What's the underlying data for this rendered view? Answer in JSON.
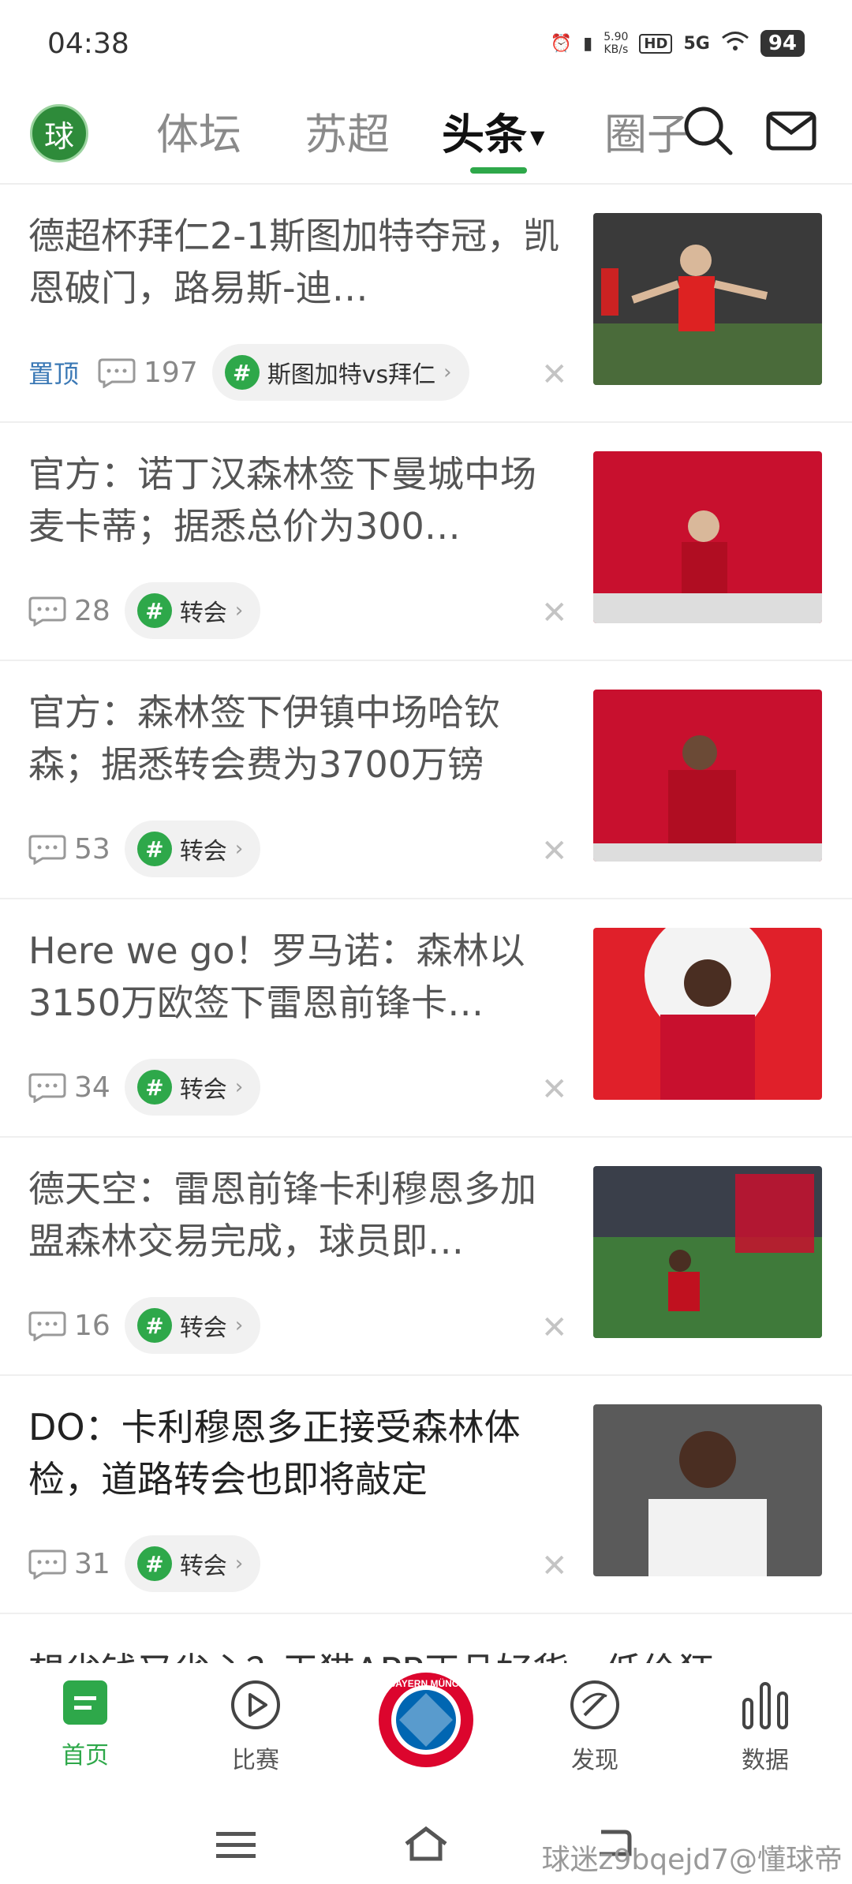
{
  "status": {
    "time": "04:38",
    "speed": "5.90",
    "speed_unit": "KB/s",
    "hd": "HD",
    "net": "5G",
    "battery": "94"
  },
  "topnav": {
    "logo": "球",
    "tabs": [
      "体坛",
      "苏超",
      "头条",
      "圈子"
    ],
    "active": "头条"
  },
  "feed": [
    {
      "title": "德超杯拜仁2-1斯图加特夺冠，凯恩破门，路易斯-迪…",
      "pin": "置顶",
      "comments": "197",
      "tag": "斯图加特vs拜仁",
      "dark": false
    },
    {
      "title": "官方：诺丁汉森林签下曼城中场麦卡蒂；据悉总价为300…",
      "comments": "28",
      "tag": "转会",
      "dark": false
    },
    {
      "title": "官方：森林签下伊镇中场哈钦森；据悉转会费为3700万镑",
      "comments": "53",
      "tag": "转会",
      "dark": false
    },
    {
      "title": "Here we go！罗马诺：森林以3150万欧签下雷恩前锋卡…",
      "comments": "34",
      "tag": "转会",
      "dark": false
    },
    {
      "title": "德天空：雷恩前锋卡利穆恩多加盟森林交易完成，球员即…",
      "comments": "16",
      "tag": "转会",
      "dark": false
    },
    {
      "title": "DO：卡利穆恩多正接受森林体检，道路转会也即将敲定",
      "comments": "31",
      "tag": "转会",
      "dark": true
    }
  ],
  "partial_title": "想省钱又省心？天猫APP正品好货，低价狂",
  "bottombar": {
    "items": [
      "首页",
      "比赛",
      "发现",
      "数据"
    ],
    "active": "首页",
    "center_badge": "FC BAYERN MÜNCHEN"
  },
  "watermark": "球迷z9bqejd7@懂球帝",
  "colors": {
    "accent": "#2ea84a",
    "pin": "#3a78b5"
  }
}
